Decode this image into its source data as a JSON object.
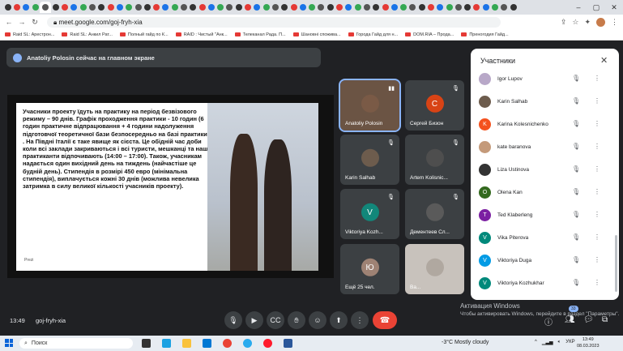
{
  "browser": {
    "url": "meet.google.com/goj-fryh-xia",
    "bookmarks": [
      "Raid SL: Арестрон...",
      "Raid SL: Анкил Рат...",
      "Полный гайд по К...",
      "RAID : Чистый \"Анк...",
      "Телеканал Рада. П...",
      "Шановні споживa...",
      "Города Гайд для н...",
      "DOM.RIA – Прода...",
      "Преногодия Гайд..."
    ]
  },
  "meet": {
    "presenting_banner": "Anatoliy Polosin сейчас на главном экране",
    "slide": {
      "text": "Учасники проекту їдуть на практику на період безвізового режиму – 90 днів. Графік проходження практики - 10 годин (6 годин практичне відпрацювання + 4 години надолуження підготовчої теоретичної бази безпосередньо на базі практики) . На Півдні Італії є таке явище як сієста. Це обідній час доби коли всі заклади закриваються і всі туристи, мешканці та наші практиканти відпочивають (14:00 – 17:00). Також, учасникам надається один вихідний день на тиждень (найчастіше це будній день). Стипендія в розмірі 450 евро (мінімальна стипендія), виплачується кожні 30 днів (можлива невелика затримка в силу великої кількості учасників проекту).",
      "watermark": "Prezi"
    },
    "tiles": [
      {
        "name": "Anatoliy Polosin",
        "initial": "",
        "color": "#7a5a46"
      },
      {
        "name": "Сергей Бизон",
        "initial": "С",
        "color": "#d84315"
      },
      {
        "name": "Karin Salhab",
        "initial": "",
        "color": "#6d5c4d"
      },
      {
        "name": "Artem Kolisnic...",
        "initial": "",
        "color": "#4e4e4e"
      },
      {
        "name": "Viktoriya Kozh...",
        "initial": "V",
        "color": "#12877a"
      },
      {
        "name": "Дементеев Сл...",
        "initial": "",
        "color": "#5a5a5a"
      },
      {
        "name": "Ещё 25 чел.",
        "initial": "Ю",
        "color": "#9e8274"
      },
      {
        "name": "Ва...",
        "initial": "",
        "color": "#b0a8a0"
      }
    ],
    "bottom": {
      "time": "13:49",
      "meeting_code": "goj-fryh-xia",
      "participants_count": "33",
      "windows_watermark_title": "Активация Windows",
      "windows_watermark_text": "Чтобы активировать Windows, перейдите в раздел \"Параметры\"."
    },
    "panel": {
      "title": "Участники",
      "participants": [
        {
          "name": "Igor Lupov",
          "initial": "",
          "color": "#b8a8c8"
        },
        {
          "name": "Karin Salhab",
          "initial": "",
          "color": "#6d5c4d"
        },
        {
          "name": "Karina Kolesnichenko",
          "initial": "K",
          "color": "#f4511e"
        },
        {
          "name": "kate baranova",
          "initial": "",
          "color": "#c49a7a"
        },
        {
          "name": "Liza Ustinova",
          "initial": "",
          "color": "#333333"
        },
        {
          "name": "Olena Kan",
          "initial": "O",
          "color": "#33691e"
        },
        {
          "name": "Ted Klaberleng",
          "initial": "T",
          "color": "#7b1fa2"
        },
        {
          "name": "Vika Piterova",
          "initial": "V",
          "color": "#00897b"
        },
        {
          "name": "Viktoriya Duga",
          "initial": "V",
          "color": "#039be5"
        },
        {
          "name": "Viktoriya Kozhukhar",
          "initial": "V",
          "color": "#00897b"
        }
      ]
    }
  },
  "taskbar": {
    "search_label": "Поиск",
    "weather": "-3°C  Mostly cloudy",
    "lang": "УКР",
    "clock_time": "13:49",
    "clock_date": "08.03.2023"
  }
}
